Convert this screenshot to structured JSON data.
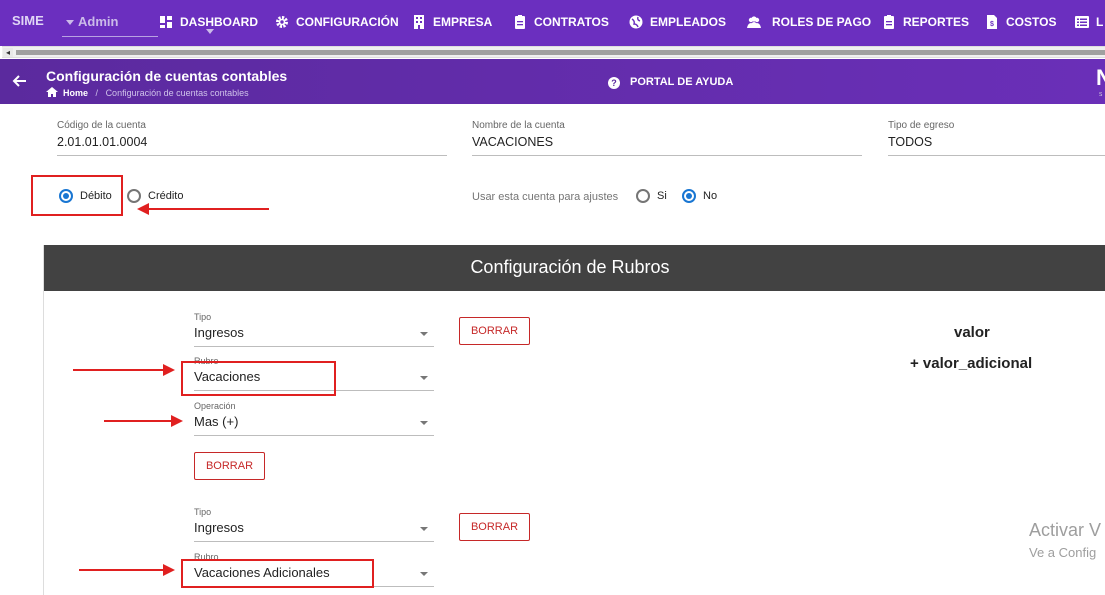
{
  "app": {
    "brand": "SIME",
    "role": "Admin"
  },
  "nav": {
    "items": [
      {
        "label": "DASHBOARD",
        "icon": "dashboard-icon"
      },
      {
        "label": "CONFIGURACIÓN",
        "icon": "gear-icon"
      },
      {
        "label": "EMPRESA",
        "icon": "building-icon"
      },
      {
        "label": "CONTRATOS",
        "icon": "clipboard-icon"
      },
      {
        "label": "EMPLEADOS",
        "icon": "globe-icon"
      },
      {
        "label": "ROLES DE PAGO",
        "icon": "users-icon"
      },
      {
        "label": "REPORTES",
        "icon": "clipboard-icon"
      },
      {
        "label": "COSTOS",
        "icon": "invoice-icon"
      },
      {
        "label": "L",
        "icon": "list-icon"
      }
    ]
  },
  "header": {
    "title": "Configuración de cuentas contables",
    "breadcrumb_home": "Home",
    "breadcrumb_sep": "/",
    "breadcrumb_current": "Configuración de cuentas contables",
    "help_label": "PORTAL DE AYUDA",
    "logo_fragment": "N",
    "logo_small": "S"
  },
  "form": {
    "codigo_label": "Código de la cuenta",
    "codigo_value": "2.01.01.01.0004",
    "nombre_label": "Nombre de la cuenta",
    "nombre_value": "VACACIONES",
    "tipo_egreso_label": "Tipo de egreso",
    "tipo_egreso_value": "TODOS",
    "debito_label": "Débito",
    "credito_label": "Crédito",
    "nature_selected": "Débito",
    "ajustes_label": "Usar esta cuenta para ajustes",
    "si_label": "Si",
    "no_label": "No",
    "ajustes_selected": "No"
  },
  "rubros": {
    "title": "Configuración de Rubros",
    "entries": [
      {
        "tipo_label": "Tipo",
        "tipo_value": "Ingresos",
        "rubro_label": "Rubro",
        "rubro_value": "Vacaciones",
        "operacion_label": "Operación",
        "operacion_value": "Mas (+)",
        "borrar_label": "BORRAR"
      },
      {
        "tipo_label": "Tipo",
        "tipo_value": "Ingresos",
        "rubro_label": "Rubro",
        "rubro_value": "Vacaciones Adicionales",
        "borrar_label": "BORRAR"
      }
    ],
    "formula_line1": "valor",
    "formula_line2": "+ valor_adicional"
  },
  "watermark": {
    "line1": "Activar V",
    "line2": "Ve a Config"
  },
  "colors": {
    "nav_bg": "#6b2fbf",
    "panel_head": "#424242",
    "accent_blue": "#1976d2",
    "danger_red": "#c62828",
    "annotation_red": "#e02020"
  }
}
